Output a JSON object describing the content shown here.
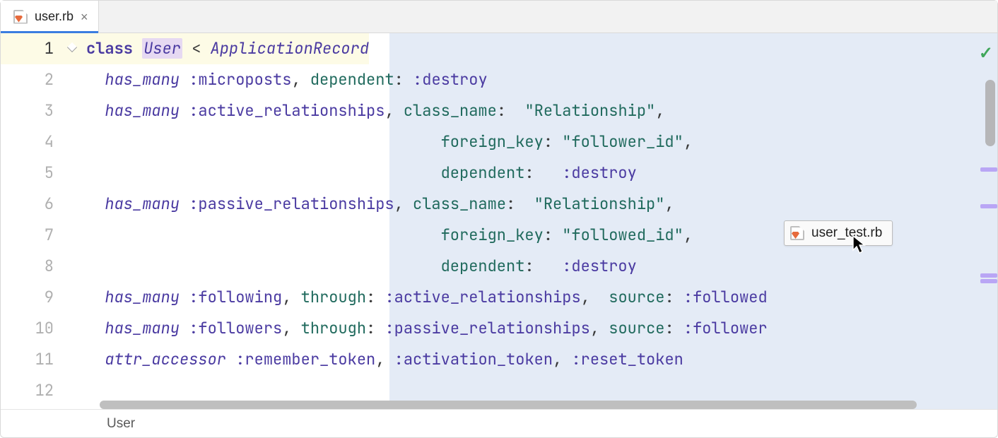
{
  "tabbar": {
    "tabs": [
      {
        "label": "user.rb",
        "active": true
      }
    ]
  },
  "drag_tab": {
    "label": "user_test.rb"
  },
  "status_ok": "✓",
  "statusbar": {
    "breadcrumb": "User"
  },
  "gutter": {
    "line_numbers": [
      "1",
      "2",
      "3",
      "4",
      "5",
      "6",
      "7",
      "8",
      "9",
      "10",
      "11",
      "12"
    ]
  },
  "code": {
    "l1": {
      "kw": "class ",
      "cls": "User",
      "op": " < ",
      "parent": "ApplicationRecord"
    },
    "l2": {
      "hm": "has_many ",
      "sym": ":microposts",
      "c1": ", ",
      "k1": "dependent",
      "c2": ": ",
      "sym2": ":destroy"
    },
    "l3": {
      "hm": "has_many ",
      "sym": ":active_relationships",
      "c1": ", ",
      "k1": "class_name",
      "c2": ":  ",
      "str": "\"Relationship\"",
      "c3": ","
    },
    "l4": {
      "k1": "foreign_key",
      "c1": ": ",
      "str": "\"follower_id\"",
      "c2": ","
    },
    "l5": {
      "k1": "dependent",
      "c1": ":   ",
      "sym": ":destroy"
    },
    "l6": {
      "hm": "has_many ",
      "sym": ":passive_relationships",
      "c1": ", ",
      "k1": "class_name",
      "c2": ":  ",
      "str": "\"Relationship\"",
      "c3": ","
    },
    "l7": {
      "k1": "foreign_key",
      "c1": ": ",
      "str": "\"followed_id\"",
      "c2": ","
    },
    "l8": {
      "k1": "dependent",
      "c1": ":   ",
      "sym": ":destroy"
    },
    "l9": {
      "hm": "has_many ",
      "sym": ":following",
      "c1": ", ",
      "k1": "through",
      "c2": ": ",
      "sym2": ":active_relationships",
      "c3": ",  ",
      "k2": "source",
      "c4": ": ",
      "sym3": ":followed"
    },
    "l10": {
      "hm": "has_many ",
      "sym": ":followers",
      "c1": ", ",
      "k1": "through",
      "c2": ": ",
      "sym2": ":passive_relationships",
      "c3": ", ",
      "k2": "source",
      "c4": ": ",
      "sym3": ":follower"
    },
    "l11": {
      "attr": "attr_accessor ",
      "sym": ":remember_token",
      "c1": ", ",
      "sym2": ":activation_token",
      "c2": ", ",
      "sym3": ":reset_token"
    }
  },
  "indent": {
    "i2": "  ",
    "i38": "                                      "
  },
  "marker_positions": [
    190,
    242,
    340,
    344
  ]
}
